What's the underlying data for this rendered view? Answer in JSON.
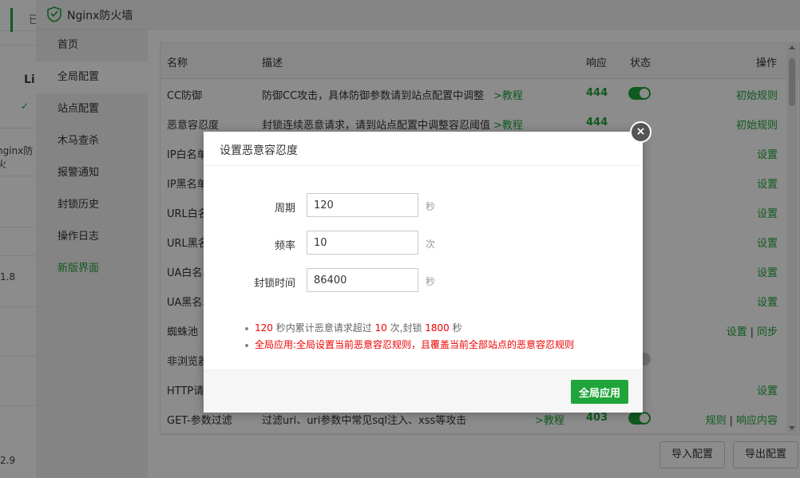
{
  "background": {
    "tab_label": "已",
    "partial_texts": [
      "Lin",
      "✓",
      "nginx防火",
      "1.8",
      "2.9"
    ]
  },
  "window": {
    "title": "Nginx防火墙"
  },
  "sidebar": {
    "items": [
      {
        "label": "首页"
      },
      {
        "label": "全局配置"
      },
      {
        "label": "站点配置"
      },
      {
        "label": "木马查杀"
      },
      {
        "label": "报警通知"
      },
      {
        "label": "封锁历史"
      },
      {
        "label": "操作日志"
      },
      {
        "label": "新版界面"
      }
    ]
  },
  "table": {
    "headers": {
      "name": "名称",
      "desc": "描述",
      "code": "响应",
      "status": "状态",
      "ops": "操作"
    },
    "rows": [
      {
        "name": "CC防御",
        "desc": "防御CC攻击，具体防御参数请到站点配置中调整",
        "link": ">教程",
        "code": "444",
        "status": "on",
        "ops": [
          "初始规则"
        ]
      },
      {
        "name": "恶意容忍度",
        "desc": "封锁连续恶意请求，请到站点配置中调整容忍阈值",
        "link": ">教程",
        "code": "444",
        "status": "",
        "ops": [
          "初始规则"
        ]
      },
      {
        "name": "IP白名单",
        "desc": "",
        "link": "",
        "code": "",
        "status": "",
        "ops": [
          "设置"
        ]
      },
      {
        "name": "IP黑名单",
        "desc": "",
        "link": "",
        "code": "",
        "status": "",
        "ops": [
          "设置"
        ]
      },
      {
        "name": "URL白名单",
        "desc": "",
        "link": "",
        "code": "",
        "status": "",
        "ops": [
          "设置"
        ]
      },
      {
        "name": "URL黑名单",
        "desc": "",
        "link": "",
        "code": "",
        "status": "",
        "ops": [
          "设置"
        ]
      },
      {
        "name": "UA白名单",
        "desc": "",
        "link": "",
        "code": "",
        "status": "",
        "ops": [
          "设置"
        ]
      },
      {
        "name": "UA黑名单",
        "desc": "",
        "link": "",
        "code": "",
        "status": "",
        "ops": [
          "设置"
        ]
      },
      {
        "name": "蜘蛛池",
        "desc": "",
        "link": "",
        "code": "",
        "status": "",
        "ops": [
          "设置",
          "同步"
        ]
      },
      {
        "name": "非浏览器",
        "desc": "",
        "link": "",
        "code": "",
        "status": "off",
        "ops": []
      },
      {
        "name": "HTTP请",
        "desc": "",
        "link": "",
        "code": "",
        "status": "",
        "ops": [
          "设置"
        ]
      },
      {
        "name": "GET-参数过滤",
        "desc": "过滤uri、uri参数中常见sql注入、xss等攻击",
        "link": ">教程",
        "code": "403",
        "status": "on",
        "ops": [
          "规则",
          "响应内容"
        ]
      }
    ]
  },
  "bottom_buttons": {
    "import": "导入配置",
    "export": "导出配置"
  },
  "dialog": {
    "title": "设置恶意容忍度",
    "close_symbol": "×",
    "fields": [
      {
        "label": "周期",
        "value": "120",
        "unit": "秒"
      },
      {
        "label": "频率",
        "value": "10",
        "unit": "次"
      },
      {
        "label": "封锁时间",
        "value": "86400",
        "unit": "秒"
      }
    ],
    "note1": {
      "period": "120",
      "t1": " 秒内累计恶意请求超过 ",
      "count": "10",
      "t2": " 次,封锁 ",
      "block": "1800",
      "t3": " 秒"
    },
    "note2": "全局应用:全局设置当前恶意容忍规则，且覆盖当前全部站点的恶意容忍规则",
    "apply_label": "全局应用"
  },
  "colors": {
    "accent": "#20a53a",
    "warning": "#ee0000"
  }
}
